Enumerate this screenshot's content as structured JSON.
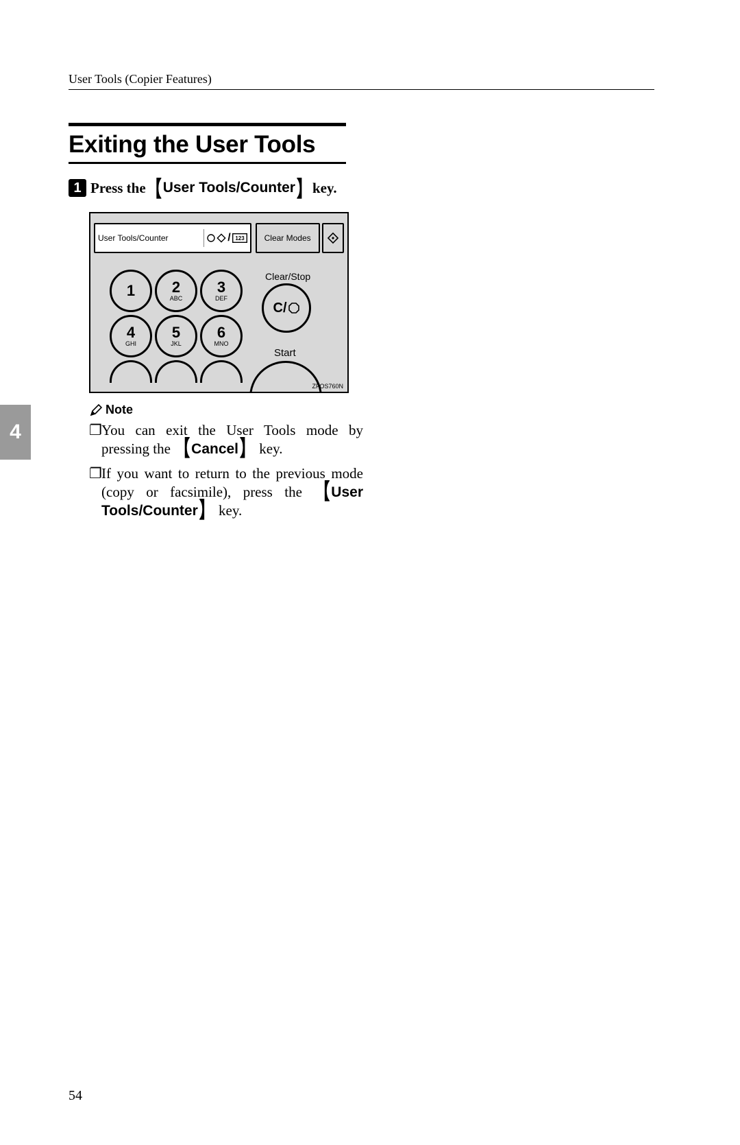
{
  "header": {
    "running": "User Tools (Copier Features)"
  },
  "title": "Exiting the User Tools",
  "step": {
    "num": "1",
    "pre": "Press the ",
    "key": "User Tools/Counter",
    "post": " key."
  },
  "panel": {
    "topLeftLabel": "User Tools/Counter",
    "clearModes": "Clear Modes",
    "clearStop": "Clear/Stop",
    "start": "Start",
    "cBtn": "C/",
    "keys": [
      {
        "n": "1",
        "l": ""
      },
      {
        "n": "2",
        "l": "ABC"
      },
      {
        "n": "3",
        "l": "DEF"
      },
      {
        "n": "4",
        "l": "GHI"
      },
      {
        "n": "5",
        "l": "JKL"
      },
      {
        "n": "6",
        "l": "MNO"
      }
    ],
    "figCode": "ZFOS760N"
  },
  "note": {
    "head": "Note",
    "items": [
      {
        "pre": "You can exit the User Tools mode by pressing the ",
        "key": "Cancel",
        "post": " key."
      },
      {
        "pre": "If you want to return to the previous mode (copy or facsimile), press the ",
        "key": "User Tools/Counter",
        "post": " key."
      }
    ]
  },
  "sideTab": "4",
  "pageNumber": "54",
  "glyph": {
    "lbrk": "【",
    "rbrk": "】",
    "square": "❐",
    "pencil": "✎"
  }
}
